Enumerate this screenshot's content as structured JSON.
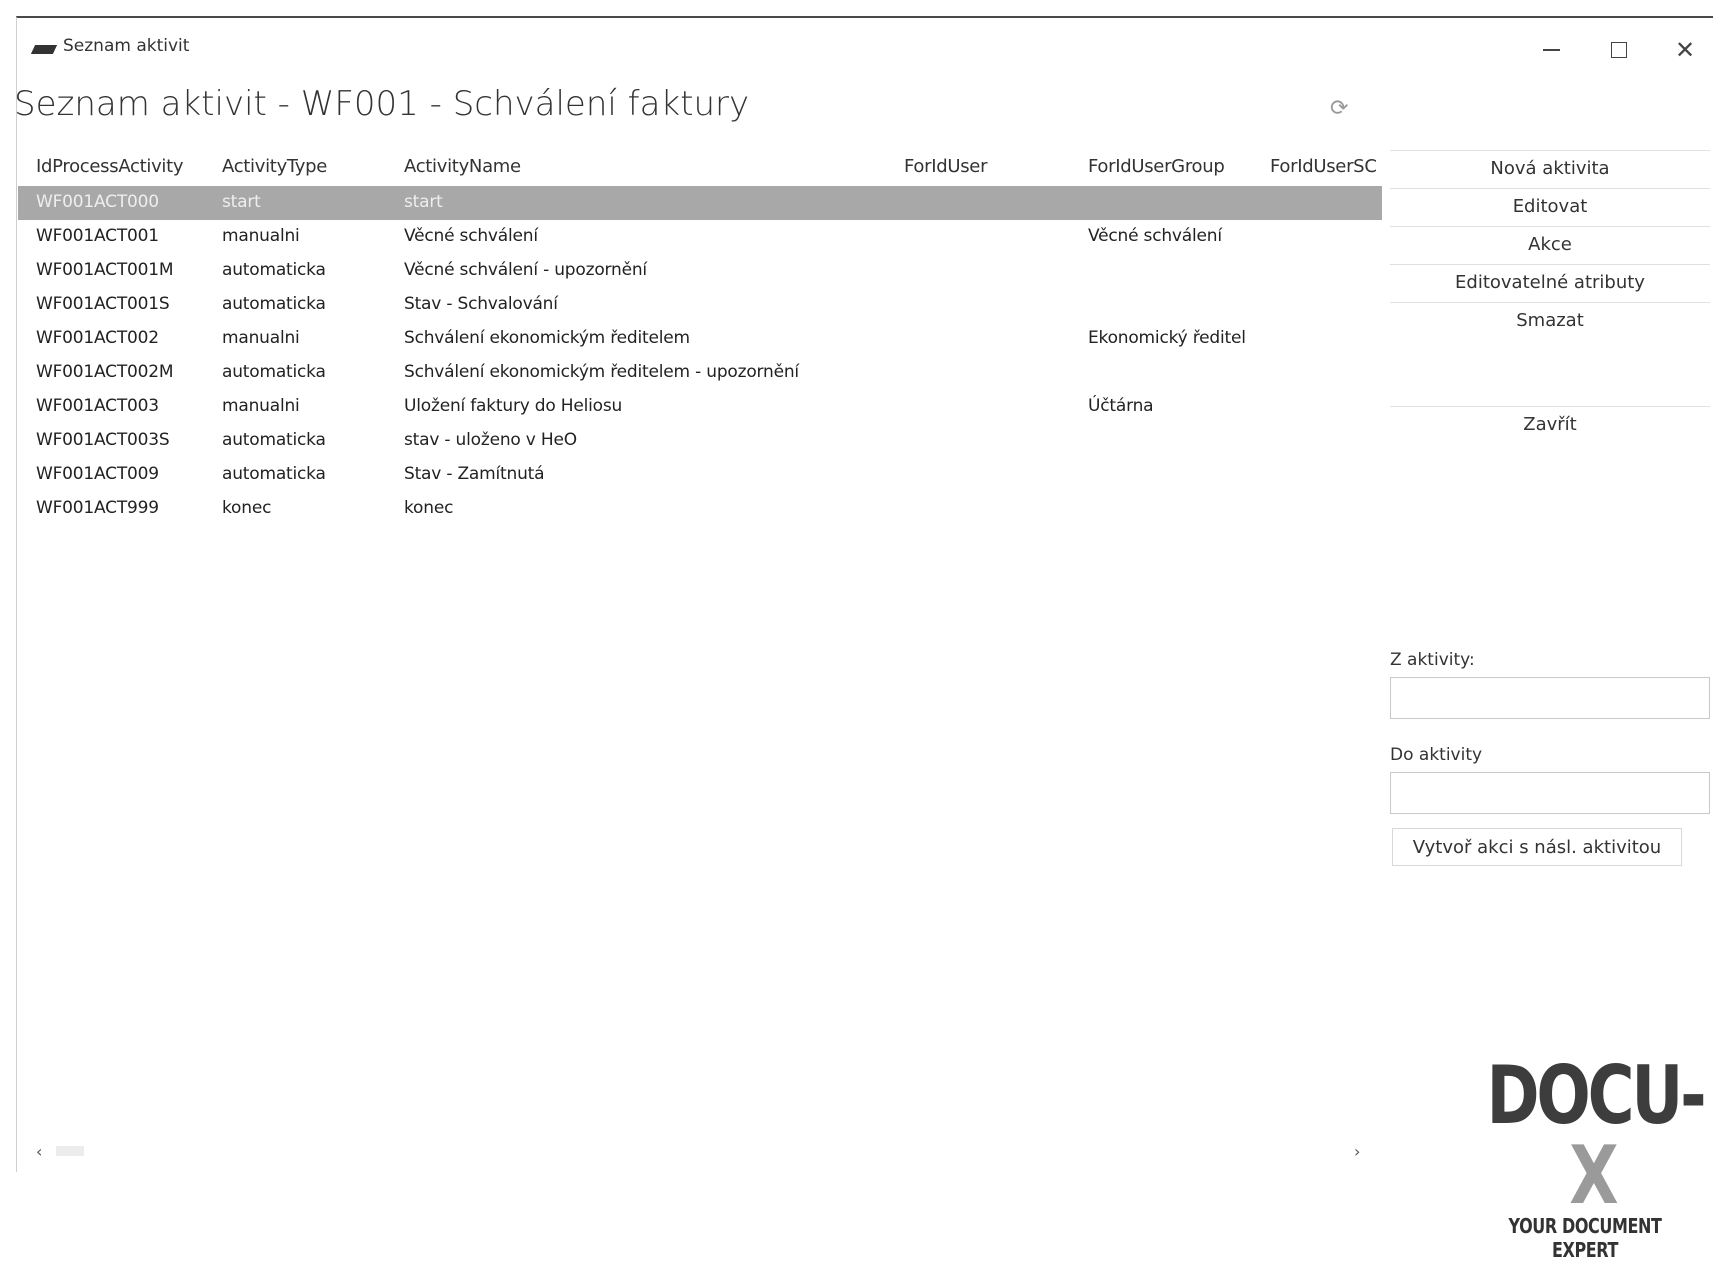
{
  "window": {
    "title": "Seznam aktivit",
    "controls": {
      "minimize": "—",
      "maximize": "☐",
      "close": "✕"
    }
  },
  "page": {
    "title": "Seznam aktivit - WF001 - Schválení faktury"
  },
  "grid": {
    "columns": [
      "IdProcessActivity",
      "ActivityType",
      "ActivityName",
      "ForIdUser",
      "ForIdUserGroup",
      "ForIdUserSC"
    ],
    "rows": [
      [
        "WF001ACT000",
        "start",
        "start",
        "",
        "",
        ""
      ],
      [
        "WF001ACT001",
        "manualni",
        "Věcné schválení",
        "",
        "Věcné schválení",
        ""
      ],
      [
        "WF001ACT001M",
        "automaticka",
        "Věcné schválení - upozornění",
        "",
        "",
        ""
      ],
      [
        "WF001ACT001S",
        "automaticka",
        "Stav - Schvalování",
        "",
        "",
        ""
      ],
      [
        "WF001ACT002",
        "manualni",
        "Schválení ekonomickým ředitelem",
        "",
        "Ekonomický ředitel",
        ""
      ],
      [
        "WF001ACT002M",
        "automaticka",
        "Schválení ekonomickým ředitelem - upozornění",
        "",
        "",
        ""
      ],
      [
        "WF001ACT003",
        "manualni",
        "Uložení faktury do Heliosu",
        "",
        "Účtárna",
        ""
      ],
      [
        "WF001ACT003S",
        "automaticka",
        "stav - uloženo v HeO",
        "",
        "",
        ""
      ],
      [
        "WF001ACT009",
        "automaticka",
        "Stav - Zamítnutá",
        "",
        "",
        ""
      ],
      [
        "WF001ACT999",
        "konec",
        "konec",
        "",
        "",
        ""
      ]
    ],
    "selected_row": 0,
    "scroll_left": "‹",
    "scroll_right": "›"
  },
  "sidebar": {
    "buttons": [
      "Nová aktivita",
      "Editovat",
      "Akce",
      "Editovatelné atributy",
      "Smazat"
    ],
    "close_button": "Zavřít",
    "from_label": "Z aktivity:",
    "from_value": "",
    "to_label": "Do aktivity",
    "to_value": "",
    "create_button": "Vytvoř akci s násl. aktivitou"
  },
  "logo": {
    "main": "DOCU-",
    "accent": "X",
    "tagline": "YOUR DOCUMENT EXPERT"
  },
  "colors": {
    "selected_row": "#a8a8a8",
    "logo_dark": "#3d3d3d",
    "logo_accent": "#9a9a9a"
  }
}
